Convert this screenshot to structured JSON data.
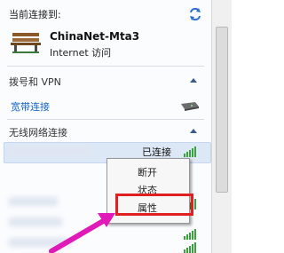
{
  "header": {
    "title": "当前连接到:"
  },
  "connection": {
    "name": "ChinaNet-Mta3",
    "status": "Internet 访问"
  },
  "sections": {
    "dialup": {
      "title": "拨号和 VPN",
      "item": "宽带连接"
    },
    "wireless": {
      "title": "无线网络连接",
      "connected_label": "已连接"
    }
  },
  "context_menu": {
    "items": [
      "断开",
      "状态",
      "属性"
    ]
  },
  "colors": {
    "highlight_border": "#e02020",
    "arrow": "#e01ab8",
    "link": "#1565c0",
    "signal": "#3aa23a"
  },
  "icons": [
    "network-refresh-icon",
    "bench-network-icon",
    "modem-icon",
    "wifi-signal-icon"
  ]
}
